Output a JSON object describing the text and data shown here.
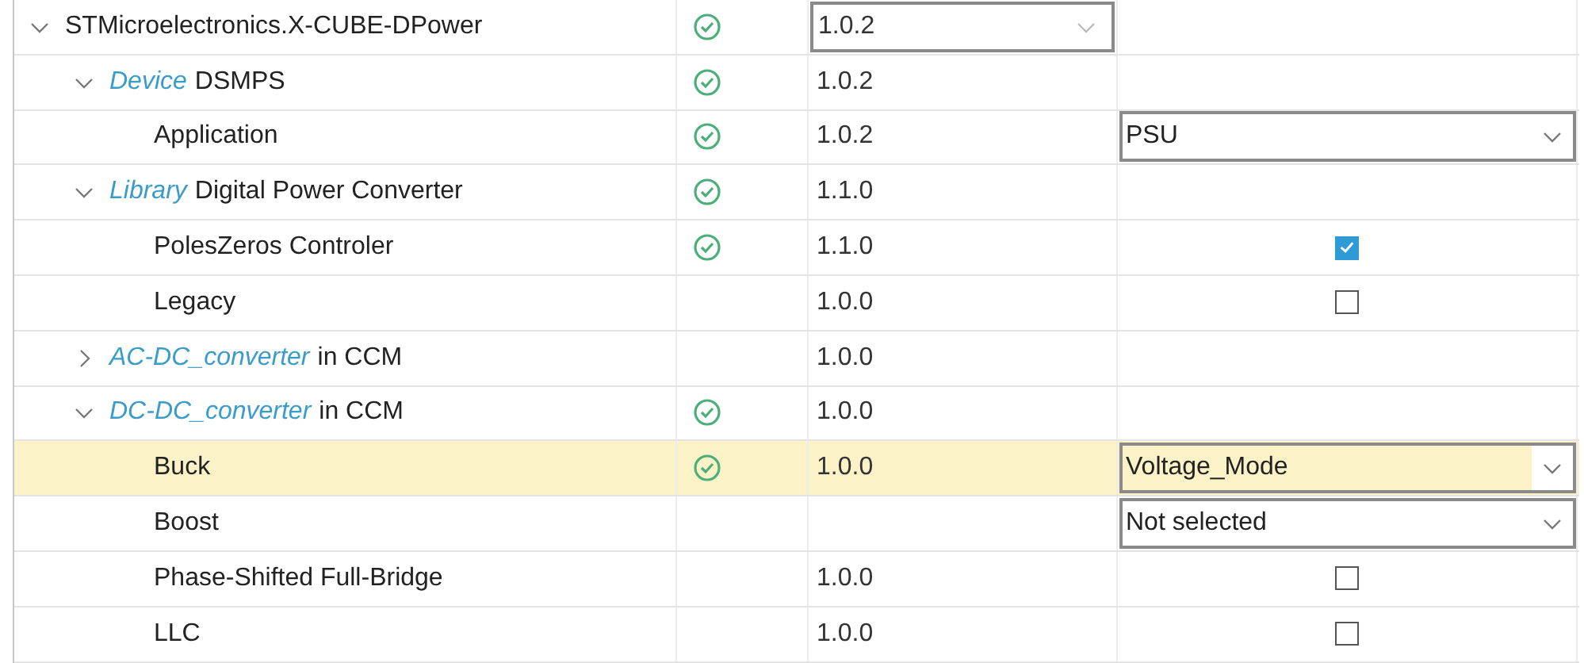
{
  "tree": [
    {
      "kind": "group",
      "name": "STMicroelectronics.X-CUBE-DPower",
      "expanded": true,
      "selected": false,
      "status_ok": true,
      "version": "1.0.2",
      "version_dropdown": true,
      "children": [
        {
          "kind": "group",
          "prefix": "Device",
          "name": "DSMPS",
          "expanded": true,
          "selected": false,
          "status_ok": true,
          "version": "1.0.2",
          "version_dropdown": false,
          "children": [
            {
              "kind": "leaf",
              "name": "Application",
              "selected": false,
              "status_ok": true,
              "version": "1.0.2",
              "version_dropdown": false,
              "selection": {
                "kind": "dropdown",
                "value": "PSU"
              }
            }
          ]
        },
        {
          "kind": "group",
          "prefix": "Library",
          "name": "Digital Power Converter",
          "expanded": true,
          "selected": false,
          "status_ok": true,
          "version": "1.1.0",
          "version_dropdown": false,
          "children": [
            {
              "kind": "leaf",
              "name": "PolesZeros Controler",
              "selected": false,
              "status_ok": true,
              "version": "1.1.0",
              "version_dropdown": false,
              "selection": {
                "kind": "checkbox",
                "checked": true
              }
            },
            {
              "kind": "leaf",
              "name": "Legacy",
              "selected": false,
              "status_ok": false,
              "version": "1.0.0",
              "version_dropdown": false,
              "selection": {
                "kind": "checkbox",
                "checked": false
              }
            }
          ]
        },
        {
          "kind": "group",
          "prefix": "AC-DC_converter",
          "name": "in CCM",
          "expanded": false,
          "selected": false,
          "status_ok": false,
          "version": "1.0.0",
          "version_dropdown": false
        },
        {
          "kind": "group",
          "prefix": "DC-DC_converter",
          "name": "in CCM",
          "expanded": true,
          "selected": false,
          "status_ok": true,
          "version": "1.0.0",
          "version_dropdown": false,
          "children": [
            {
              "kind": "leaf",
              "name": "Buck",
              "selected": true,
              "status_ok": true,
              "version": "1.0.0",
              "version_dropdown": false,
              "selection": {
                "kind": "dropdown",
                "value": "Voltage_Mode"
              }
            },
            {
              "kind": "leaf",
              "name": "Boost",
              "selected": false,
              "status_ok": false,
              "version_dropdown": false,
              "selection": {
                "kind": "dropdown",
                "value": "Not selected"
              }
            },
            {
              "kind": "leaf",
              "name": "Phase-Shifted Full-Bridge",
              "selected": false,
              "status_ok": false,
              "version": "1.0.0",
              "version_dropdown": false,
              "selection": {
                "kind": "checkbox",
                "checked": false
              }
            },
            {
              "kind": "leaf",
              "name": "LLC",
              "selected": false,
              "status_ok": false,
              "version": "1.0.0",
              "version_dropdown": false,
              "selection": {
                "kind": "checkbox",
                "checked": false
              }
            }
          ]
        }
      ]
    }
  ]
}
